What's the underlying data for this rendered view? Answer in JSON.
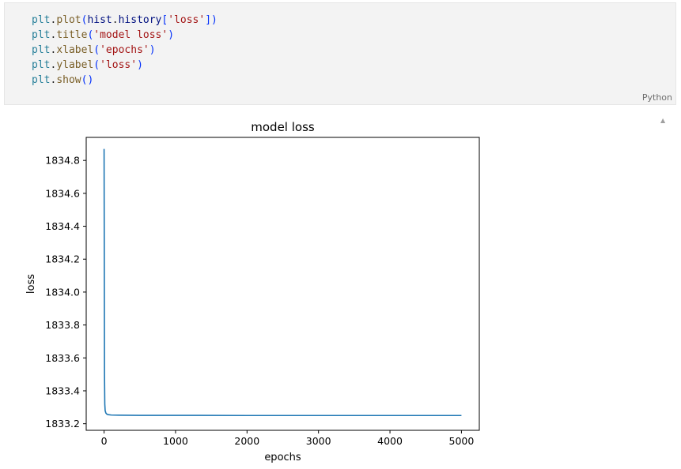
{
  "code_cell": {
    "lines": [
      [
        {
          "t": "plt",
          "c": "tok-var"
        },
        {
          "t": ".",
          "c": "tok-dot"
        },
        {
          "t": "plot",
          "c": "tok-fn"
        },
        {
          "t": "(",
          "c": "tok-punc"
        },
        {
          "t": "hist",
          "c": "tok-plain"
        },
        {
          "t": ".",
          "c": "tok-dot"
        },
        {
          "t": "history",
          "c": "tok-plain"
        },
        {
          "t": "[",
          "c": "tok-punc"
        },
        {
          "t": "'loss'",
          "c": "tok-str"
        },
        {
          "t": "])",
          "c": "tok-punc"
        }
      ],
      [
        {
          "t": "plt",
          "c": "tok-var"
        },
        {
          "t": ".",
          "c": "tok-dot"
        },
        {
          "t": "title",
          "c": "tok-fn"
        },
        {
          "t": "(",
          "c": "tok-punc"
        },
        {
          "t": "'model loss'",
          "c": "tok-str"
        },
        {
          "t": ")",
          "c": "tok-punc"
        }
      ],
      [
        {
          "t": "plt",
          "c": "tok-var"
        },
        {
          "t": ".",
          "c": "tok-dot"
        },
        {
          "t": "xlabel",
          "c": "tok-fn"
        },
        {
          "t": "(",
          "c": "tok-punc"
        },
        {
          "t": "'epochs'",
          "c": "tok-str"
        },
        {
          "t": ")",
          "c": "tok-punc"
        }
      ],
      [
        {
          "t": "plt",
          "c": "tok-var"
        },
        {
          "t": ".",
          "c": "tok-dot"
        },
        {
          "t": "ylabel",
          "c": "tok-fn"
        },
        {
          "t": "(",
          "c": "tok-punc"
        },
        {
          "t": "'loss'",
          "c": "tok-str"
        },
        {
          "t": ")",
          "c": "tok-punc"
        }
      ],
      [
        {
          "t": "plt",
          "c": "tok-var"
        },
        {
          "t": ".",
          "c": "tok-dot"
        },
        {
          "t": "show",
          "c": "tok-fn"
        },
        {
          "t": "()",
          "c": "tok-punc"
        }
      ]
    ],
    "language_label": "Python"
  },
  "output": {
    "collapse_icon": "collapse-up-icon"
  },
  "chart_data": {
    "type": "line",
    "title": "model loss",
    "xlabel": "epochs",
    "ylabel": "loss",
    "xlim": [
      -250,
      5250
    ],
    "ylim": [
      1833.16,
      1834.94
    ],
    "xticks": [
      0,
      1000,
      2000,
      3000,
      4000,
      5000
    ],
    "xtick_labels": [
      "0",
      "1000",
      "2000",
      "3000",
      "4000",
      "5000"
    ],
    "yticks": [
      1833.2,
      1833.4,
      1833.6,
      1833.8,
      1834.0,
      1834.2,
      1834.4,
      1834.6,
      1834.8
    ],
    "ytick_labels": [
      "1833.2",
      "1833.4",
      "1833.6",
      "1833.8",
      "1834.0",
      "1834.2",
      "1834.4",
      "1834.6",
      "1834.8"
    ],
    "grid": false,
    "series": [
      {
        "color": "#1f77b4",
        "x": [
          0,
          3,
          6,
          10,
          15,
          25,
          40,
          60,
          100,
          200,
          500,
          1000,
          2000,
          3000,
          4000,
          5000
        ],
        "y": [
          1834.87,
          1834.2,
          1833.5,
          1833.32,
          1833.28,
          1833.265,
          1833.258,
          1833.255,
          1833.253,
          1833.252,
          1833.251,
          1833.251,
          1833.25,
          1833.25,
          1833.25,
          1833.25
        ]
      }
    ]
  }
}
